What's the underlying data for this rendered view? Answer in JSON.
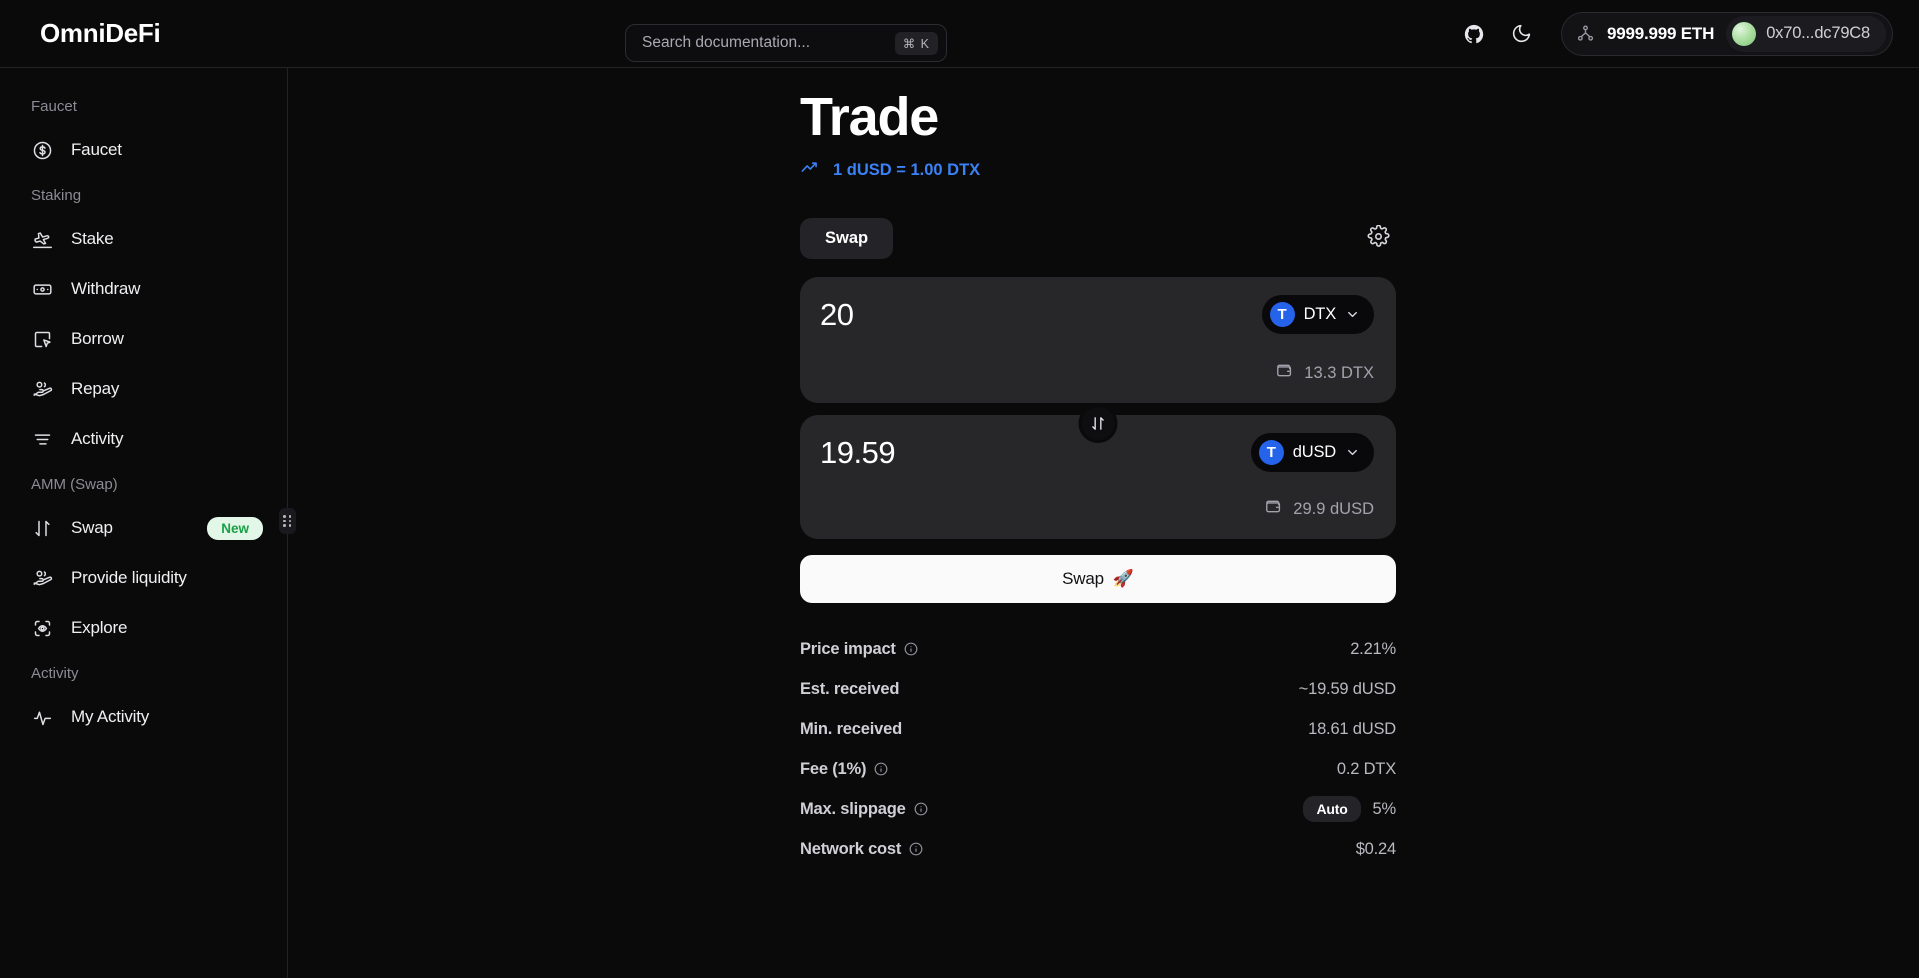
{
  "header": {
    "brand": "OmniDeFi",
    "search": {
      "placeholder": "Search documentation...",
      "shortcut": "⌘ K"
    },
    "github_icon": "github-icon",
    "theme_icon": "moon-icon",
    "network_icon": "network-nodes-icon",
    "eth_balance": "9999.999 ETH",
    "address": "0x70...dc79C8"
  },
  "sidebar": {
    "sections": [
      {
        "label": "Faucet",
        "items": [
          {
            "label": "Faucet",
            "icon": "dollar-circle-icon",
            "badge": ""
          }
        ]
      },
      {
        "label": "Staking",
        "items": [
          {
            "label": "Stake",
            "icon": "plane-takeoff-icon",
            "badge": ""
          },
          {
            "label": "Withdraw",
            "icon": "banknote-icon",
            "badge": ""
          },
          {
            "label": "Borrow",
            "icon": "cursor-box-icon",
            "badge": ""
          },
          {
            "label": "Repay",
            "icon": "hand-coins-icon",
            "badge": ""
          },
          {
            "label": "Activity",
            "icon": "lines-icon",
            "badge": ""
          }
        ]
      },
      {
        "label": "AMM (Swap)",
        "items": [
          {
            "label": "Swap",
            "icon": "arrows-up-down-icon",
            "badge": "New"
          },
          {
            "label": "Provide liquidity",
            "icon": "hand-coins-icon",
            "badge": ""
          },
          {
            "label": "Explore",
            "icon": "scan-eye-icon",
            "badge": ""
          }
        ]
      },
      {
        "label": "Activity",
        "items": [
          {
            "label": "My Activity",
            "icon": "pulse-icon",
            "badge": ""
          }
        ]
      }
    ]
  },
  "trade": {
    "title": "Trade",
    "rate": "1 dUSD = 1.00 DTX",
    "rate_icon": "trending-up-icon",
    "tab_swap": "Swap",
    "settings_icon": "gear-icon",
    "from": {
      "amount": "20",
      "token": "DTX",
      "token_logo": "T",
      "balance": "13.3 DTX",
      "wallet_icon": "wallet-icon"
    },
    "to": {
      "amount": "19.59",
      "token": "dUSD",
      "token_logo": "T",
      "balance": "29.9 dUSD",
      "wallet_icon": "wallet-icon"
    },
    "toggle_icon": "swap-vertical-icon",
    "action_label": "Swap",
    "action_emoji": "🚀",
    "details": [
      {
        "label": "Price impact",
        "info": true,
        "chip": "",
        "value": "2.21%"
      },
      {
        "label": "Est. received",
        "info": false,
        "chip": "",
        "value": "~19.59 dUSD"
      },
      {
        "label": "Min. received",
        "info": false,
        "chip": "",
        "value": "18.61 dUSD"
      },
      {
        "label": "Fee (1%)",
        "info": true,
        "chip": "",
        "value": "0.2 DTX"
      },
      {
        "label": "Max. slippage",
        "info": true,
        "chip": "Auto",
        "value": "5%"
      },
      {
        "label": "Network cost",
        "info": true,
        "chip": "",
        "value": "$0.24"
      }
    ]
  },
  "colors": {
    "accent_blue": "#3b82f6",
    "badge_green": "#19a047",
    "panel": "#27272a"
  }
}
